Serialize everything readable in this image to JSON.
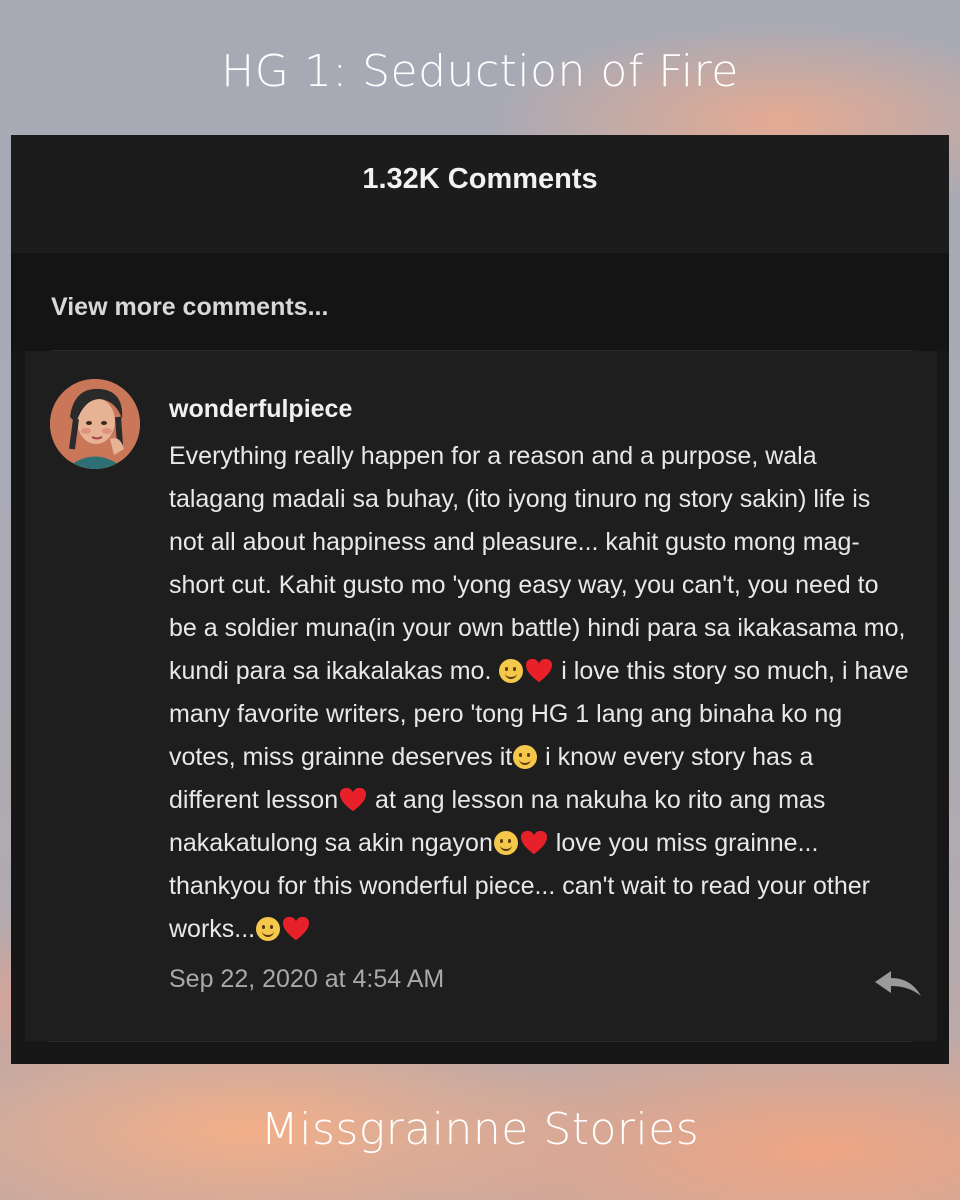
{
  "header": {
    "title": "HG 1: Seduction of Fire"
  },
  "footer": {
    "title": "Missgrainne Stories"
  },
  "comments_panel": {
    "count_label": "1.32K Comments",
    "view_more_label": "View more comments...",
    "comment": {
      "username": "wonderfulpiece",
      "segments": [
        "Everything really happen for a reason and a purpose, wala talagang madali sa buhay, (ito iyong tinuro ng story sakin) life is not all about happiness and pleasure... kahit gusto mong mag-short cut. Kahit gusto mo 'yong easy way, you can't, you need to be a soldier muna(in your own battle) hindi para sa ikakasama mo, kundi para sa ikakalakas mo. ",
        " i love this story so much, i have many favorite writers, pero 'tong HG 1 lang ang binaha ko ng votes, miss grainne deserves it",
        " i know every story has a different lesson",
        " at ang lesson na nakuha ko rito ang mas nakakatulong sa akin ngayon",
        " love you miss grainne... thankyou for this wonderful piece... can't wait to read your other works..."
      ],
      "timestamp": "Sep 22, 2020 at 4:54 AM",
      "icons": {
        "avatar": "avatar-illustration",
        "smile_emoji": "smiling-face-emoji",
        "heart_emoji": "red-heart-emoji",
        "reply": "reply-arrow-icon"
      }
    }
  },
  "colors": {
    "panel_bg": "#171717",
    "comment_bg": "#1e1e1e",
    "text": "#e8e8e8",
    "muted_text": "#a9a9a9",
    "heart": "#e8202a",
    "smile": "#f5c84c"
  }
}
